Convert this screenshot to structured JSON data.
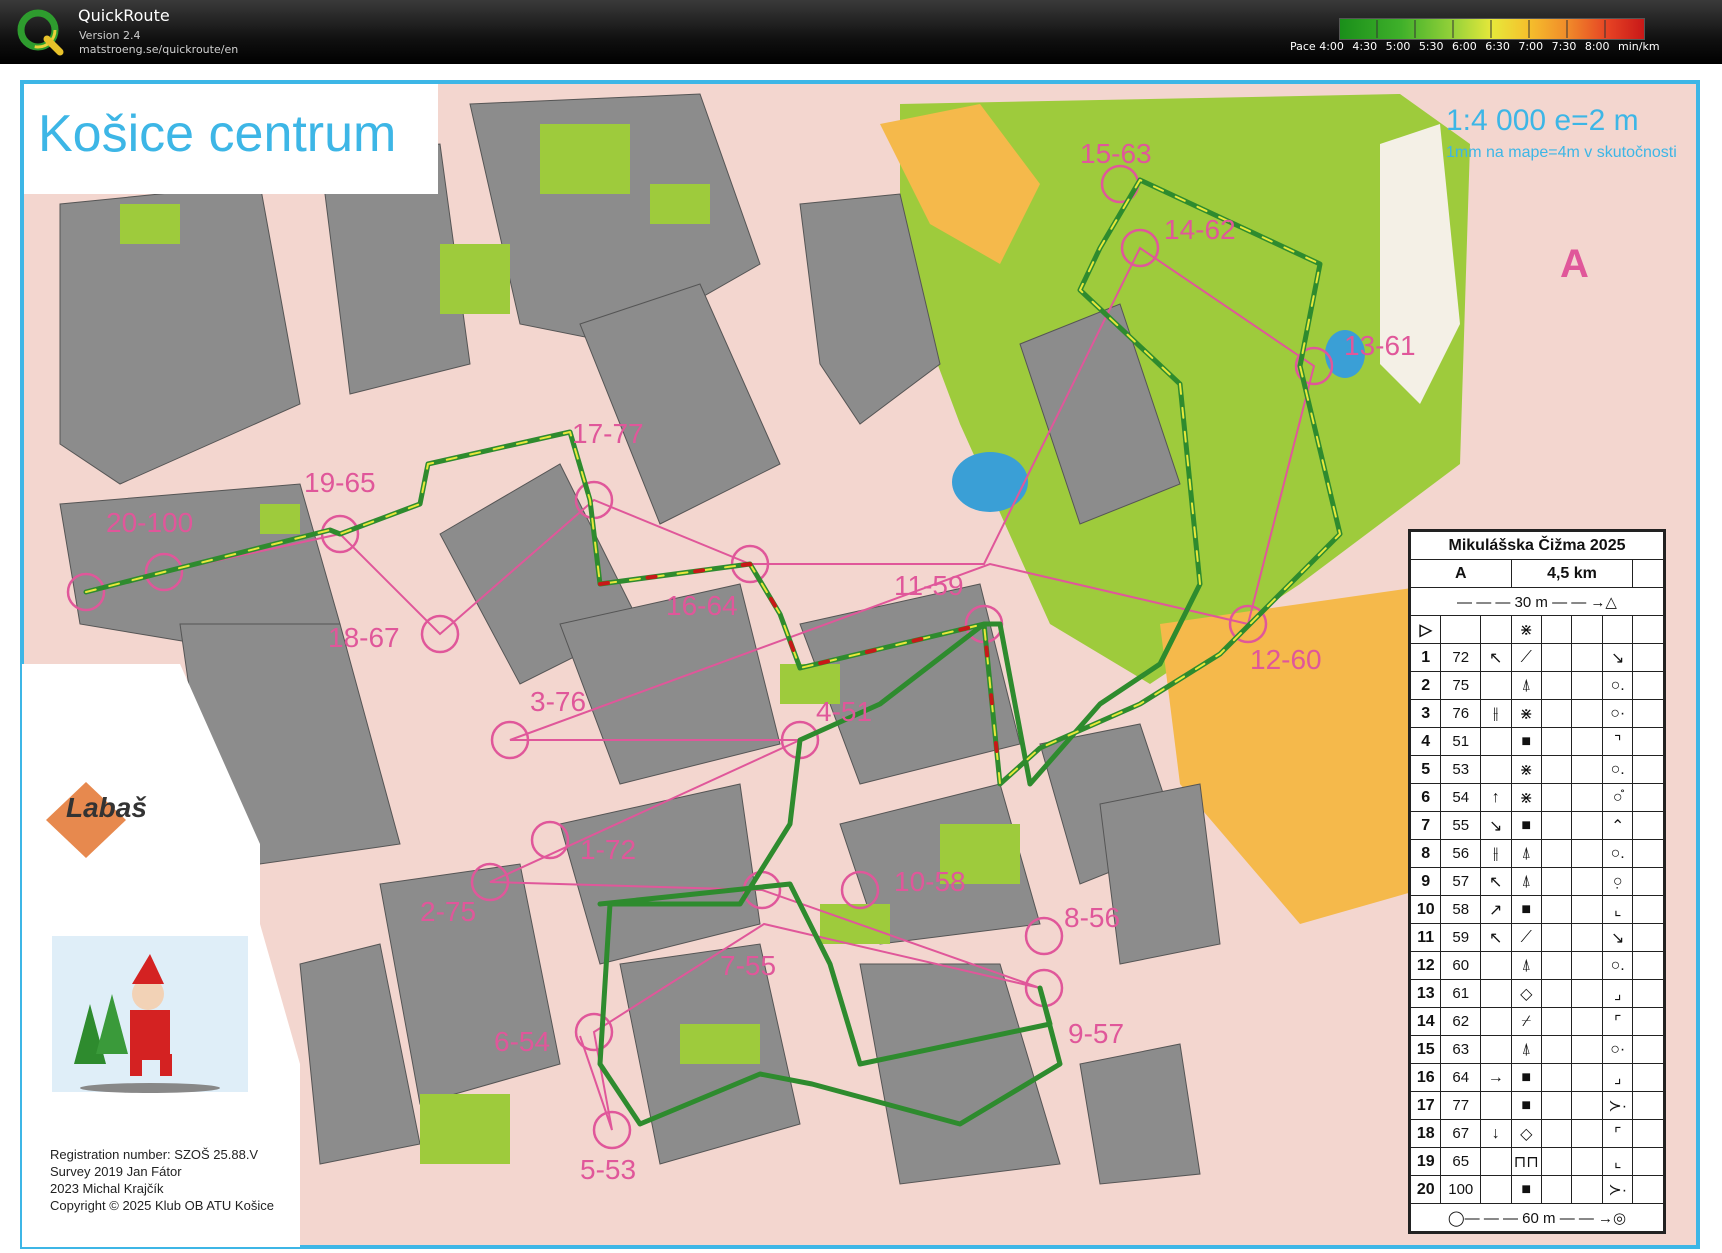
{
  "app": {
    "name": "QuickRoute",
    "version": "Version 2.4",
    "url": "matstroeng.se/quickroute/en"
  },
  "pace_scale": {
    "labels": [
      "Pace 4:00",
      "4:30",
      "5:00",
      "5:30",
      "6:00",
      "6:30",
      "7:00",
      "7:30",
      "8:00",
      "min/km"
    ],
    "colors": [
      "#1a8f1a",
      "#9ad33a",
      "#e7e83a",
      "#f08a2a",
      "#c81818"
    ]
  },
  "map": {
    "title": "Košice centrum",
    "scale": "1:4 000  e=2 m",
    "scale_note": "1mm na mape=4m v skutočnosti",
    "course_letter": "A",
    "sponsor_logo": "Labaš",
    "credits": [
      "Registration number: SZOŠ 25.88.V",
      "Survey 2019 Jan Fátor",
      "2023 Michal Krajčík",
      "Copyright © 2025 Klub OB ATU Košice"
    ],
    "control_labels": [
      {
        "text": "20-100"
      },
      {
        "text": "19-65"
      },
      {
        "text": "17-77"
      },
      {
        "text": "16-64"
      },
      {
        "text": "18-67"
      },
      {
        "text": "3-76"
      },
      {
        "text": "4-51"
      },
      {
        "text": "11-59"
      },
      {
        "text": "15-63"
      },
      {
        "text": "14-62"
      },
      {
        "text": "13-61"
      },
      {
        "text": "12-60"
      },
      {
        "text": "1-72"
      },
      {
        "text": "2-75"
      },
      {
        "text": "10-58"
      },
      {
        "text": "8-56"
      },
      {
        "text": "7-55"
      },
      {
        "text": "9-57"
      },
      {
        "text": "6-54"
      },
      {
        "text": "5-53"
      }
    ]
  },
  "control_description": {
    "event": "Mikulášska Čižma 2025",
    "course": "A",
    "length": "4,5 km",
    "start_marking": "30 m",
    "finish_marking": "60 m",
    "rows": [
      {
        "n": "1",
        "code": "72",
        "c": "↖",
        "feat": "⟋"
      },
      {
        "n": "2",
        "code": "75",
        "c": "",
        "feat": "⍋"
      },
      {
        "n": "3",
        "code": "76",
        "c": "⫲",
        "feat": "⋇"
      },
      {
        "n": "4",
        "code": "51",
        "c": "",
        "feat": "■"
      },
      {
        "n": "5",
        "code": "53",
        "c": "",
        "feat": "⋇"
      },
      {
        "n": "6",
        "code": "54",
        "c": "↑",
        "feat": "⋇"
      },
      {
        "n": "7",
        "code": "55",
        "c": "↘",
        "feat": "■"
      },
      {
        "n": "8",
        "code": "56",
        "c": "⫲",
        "feat": "⍋"
      },
      {
        "n": "9",
        "code": "57",
        "c": "↖",
        "feat": "⍋"
      },
      {
        "n": "10",
        "code": "58",
        "c": "↗",
        "feat": "■"
      },
      {
        "n": "11",
        "code": "59",
        "c": "↖",
        "feat": "⟋"
      },
      {
        "n": "12",
        "code": "60",
        "c": "",
        "feat": "⍋"
      },
      {
        "n": "13",
        "code": "61",
        "c": "",
        "feat": "◇"
      },
      {
        "n": "14",
        "code": "62",
        "c": "",
        "feat": "⌿"
      },
      {
        "n": "15",
        "code": "63",
        "c": "",
        "feat": "⍋"
      },
      {
        "n": "16",
        "code": "64",
        "c": "→",
        "feat": "■"
      },
      {
        "n": "17",
        "code": "77",
        "c": "",
        "feat": "■"
      },
      {
        "n": "18",
        "code": "67",
        "c": "↓",
        "feat": "◇"
      },
      {
        "n": "19",
        "code": "65",
        "c": "",
        "feat": "⊓⊓"
      },
      {
        "n": "20",
        "code": "100",
        "c": "",
        "feat": "■"
      }
    ],
    "locations": [
      "↘",
      "○.",
      "○·",
      "⌝",
      "○.",
      "○̊",
      "⌃",
      "○.",
      "○̣",
      "⌞",
      "↘",
      "○.",
      "⌟",
      "⌜",
      "○·",
      "⌟",
      "≻·",
      "⌜",
      "⌞",
      "≻·"
    ]
  }
}
